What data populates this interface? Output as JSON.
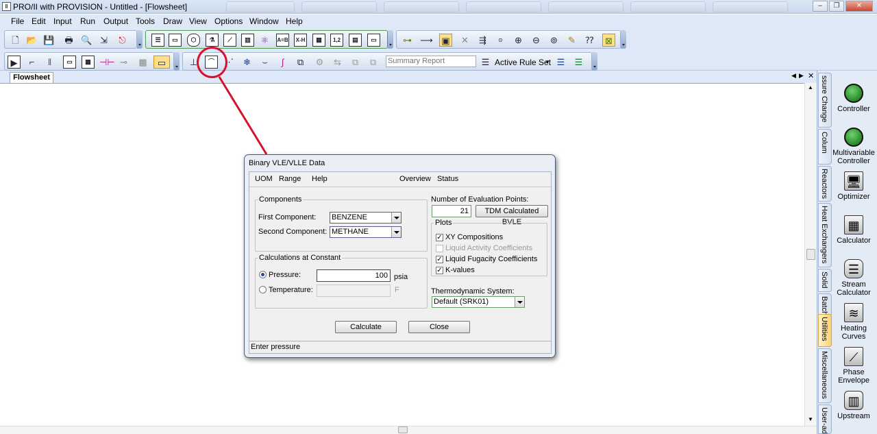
{
  "app": {
    "title": "PRO/II with PROVISION - Untitled - [Flowsheet]"
  },
  "menu": [
    "File",
    "Edit",
    "Input",
    "Run",
    "Output",
    "Tools",
    "Draw",
    "View",
    "Options",
    "Window",
    "Help"
  ],
  "toolbar": {
    "summary_report": "Summary Report",
    "active_rule_set": "Active Rule Set",
    "icon_ab": "A=B",
    "icon_xh": "X-H",
    "icon_12": "1,2"
  },
  "tabs": {
    "flowsheet": "Flowsheet"
  },
  "palette": {
    "tabs": [
      "ssure Change",
      "Colum",
      "Reactors",
      "Heat Exchangers",
      "Solid",
      "Batch",
      "Utilities",
      "Miscellaneous",
      "User-ad"
    ],
    "items": [
      {
        "label": "Controller",
        "icon": "controller-icon"
      },
      {
        "label": "Multivariable Controller",
        "icon": "multivariable-controller-icon"
      },
      {
        "label": "Optimizer",
        "icon": "optimizer-icon"
      },
      {
        "label": "Calculator",
        "icon": "calculator-icon"
      },
      {
        "label": "Stream Calculator",
        "icon": "stream-calculator-icon"
      },
      {
        "label": "Heating Curves",
        "icon": "heating-curves-icon"
      },
      {
        "label": "Phase Envelope",
        "icon": "phase-envelope-icon"
      },
      {
        "label": "Upstream",
        "icon": "upstream-icon"
      }
    ]
  },
  "dialog": {
    "title": "Binary VLE/VLLE Data",
    "menu": {
      "uom": "UOM",
      "range": "Range",
      "help": "Help",
      "overview": "Overview",
      "status": "Status"
    },
    "components": {
      "legend": "Components",
      "first_label": "First Component:",
      "first_value": "BENZENE",
      "second_label": "Second Component:",
      "second_value": "METHANE"
    },
    "constant": {
      "legend": "Calculations at Constant",
      "pressure_label": "Pressure:",
      "pressure_value": "100",
      "pressure_unit": "psia",
      "temperature_label": "Temperature:",
      "temperature_value": "",
      "temperature_unit": "F",
      "selected": "pressure"
    },
    "eval": {
      "label": "Number of Evaluation Points:",
      "value": "21",
      "tdm_button": "TDM Calculated BVLE"
    },
    "plots": {
      "legend": "Plots",
      "items": [
        {
          "label": "XY Compositions",
          "checked": true,
          "enabled": true
        },
        {
          "label": "Liquid Activity Coefficients",
          "checked": false,
          "enabled": false
        },
        {
          "label": "Liquid Fugacity Coefficients",
          "checked": true,
          "enabled": true
        },
        {
          "label": "K-values",
          "checked": true,
          "enabled": true
        }
      ]
    },
    "thermo": {
      "label": "Thermodynamic System:",
      "value": "Default (SRK01)"
    },
    "buttons": {
      "calculate": "Calculate",
      "close": "Close"
    },
    "status_text": "Enter pressure"
  },
  "colors": {
    "highlight_circle": "#d6112b",
    "controller_green": "#1e9b1e"
  }
}
